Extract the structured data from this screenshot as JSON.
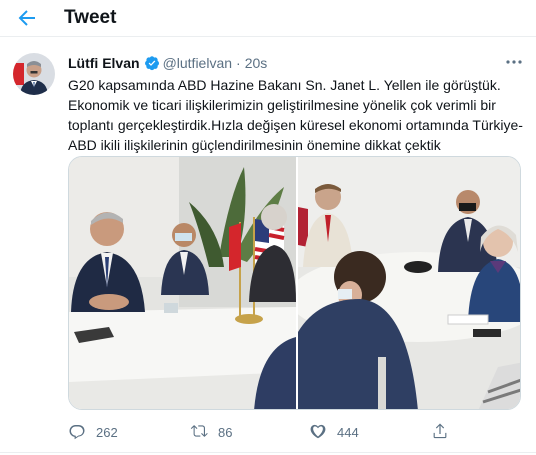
{
  "header": {
    "title": "Tweet"
  },
  "tweet": {
    "author_name": "Lütfi Elvan",
    "handle": "@lutfielvan",
    "separator": "·",
    "time": "20s",
    "lines": [
      "G20 kapsamında ABD Hazine Bakanı Sn. Janet L. Yellen ile görüştük.",
      "Ekonomik ve ticari ilişkilerimizin geliştirilmesine yönelik çok verimli bir",
      "toplantı gerçekleştirdik.Hızla değişen küresel ekonomi ortamında Türkiye-",
      "ABD ikili ilişkilerinin güçlendirilmesinin önemine dikkat çektik"
    ]
  },
  "actions": {
    "replies": "262",
    "retweets": "86",
    "likes": "444"
  },
  "icons": {
    "back": "arrow-left-icon",
    "verified": "verified-badge-icon",
    "more": "more-icon",
    "reply": "reply-icon",
    "retweet": "retweet-icon",
    "like": "heart-icon",
    "share": "share-icon"
  },
  "colors": {
    "accent": "#1d9bf0",
    "secondary_text": "#5b7083",
    "primary_text": "#0f1419",
    "divider": "#ebeef0"
  }
}
